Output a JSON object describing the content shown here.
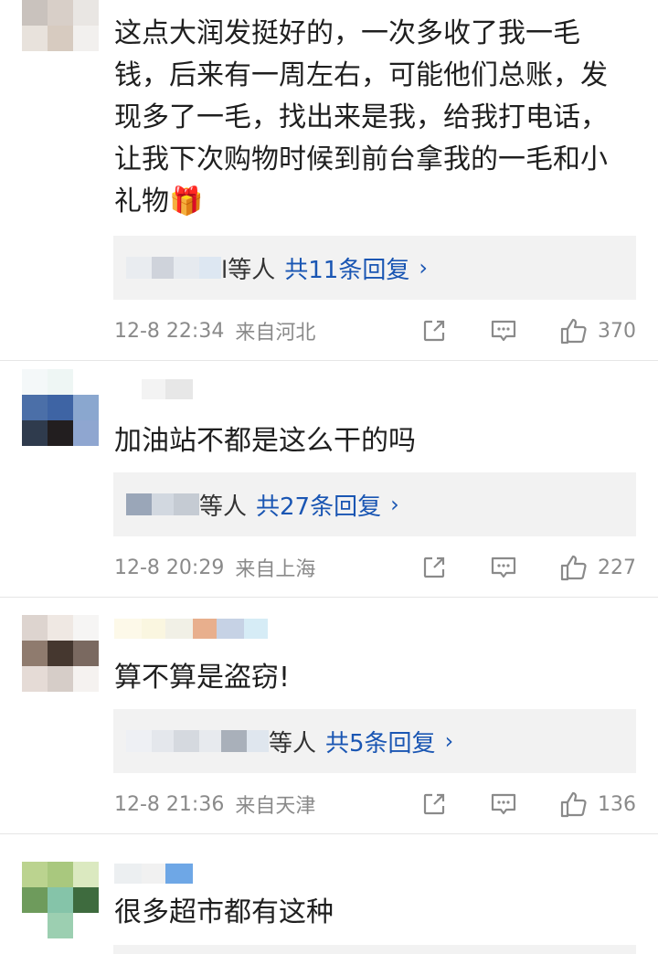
{
  "comments": [
    {
      "text": "这点大润发挺好的，一次多收了我一毛钱，后来有一周左右，可能他们总账，发现多了一毛，找出来是我，给我打电话，让我下次购物时候到前台拿我的一毛和小礼物🎁",
      "replies": {
        "suffix": "l等人",
        "count": "共11条回复",
        "chevron": "›"
      },
      "time": "12-8 22:34",
      "location": "来自河北",
      "likes": "370",
      "avatar_colors": [
        "#b3aeab",
        "#7b6e6a",
        "#d9d6d3",
        "#c9c2bd",
        "#d8cfc8",
        "#e9e6e3",
        "#e8e2dc",
        "#d7cbc0",
        "#f2f0ee"
      ],
      "name_colors": []
    },
    {
      "text": "加油站不都是这么干的吗",
      "replies": {
        "suffix": "等人",
        "count": "共27条回复",
        "chevron": "›"
      },
      "time": "12-8 20:29",
      "location": "来自上海",
      "likes": "227",
      "avatar_colors": [
        "#f4f8f9",
        "#eef6f4",
        "#ffffff",
        "#4b6fa8",
        "#3e64a4",
        "#8aa7cf",
        "#2f3b4d",
        "#221e1f",
        "#8fa6d0"
      ],
      "name_colors": [
        "#ffffff",
        "#f3f3f3",
        "#e7e7e7"
      ]
    },
    {
      "text": "算不算是盗窃!",
      "replies": {
        "suffix": "等人",
        "count": "共5条回复",
        "chevron": "›"
      },
      "time": "12-8 21:36",
      "location": "来自天津",
      "likes": "136",
      "avatar_colors": [
        "#ddd4cf",
        "#efe8e3",
        "#f6f5f4",
        "#8f7b6e",
        "#45372f",
        "#7a6960",
        "#e5dbd6",
        "#d6cdc8",
        "#f5f2f0"
      ],
      "name_colors": [
        "#fdf9e9",
        "#faf6e0",
        "#f1f0e6",
        "#e8af8d",
        "#c6d2e5",
        "#d6ecf6"
      ]
    },
    {
      "text": "很多超市都有这种",
      "avatar_colors": [
        "#bbd38f",
        "#a9c87e",
        "#dbe9c0",
        "#6e9b5c",
        "#85c4a9",
        "#3e6b3e",
        "#ffffff",
        "#9ccfb1",
        "#ffffff"
      ],
      "name_colors": [
        "#eceff1",
        "#f1f1f1",
        "#6ea7e6"
      ]
    }
  ],
  "reply_blur_colors": [
    [
      "#e9ecf0",
      "#cfd3db",
      "#e6eaef",
      "#dde7f2"
    ],
    [
      "#9aa6b8",
      "#d2d8e0",
      "#c5cbd3"
    ],
    [
      "#eef0f4",
      "#e4e7ec",
      "#d5d9df",
      "#e7eaee",
      "#a9b0ba",
      "#dfe6ee"
    ]
  ]
}
